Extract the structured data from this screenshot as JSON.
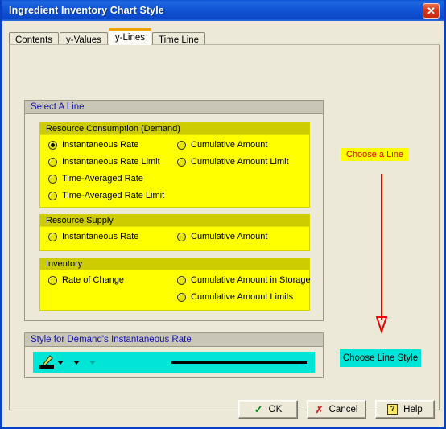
{
  "window": {
    "title": "Ingredient Inventory Chart Style",
    "close_label": "✕"
  },
  "tabs": [
    {
      "label": "Contents",
      "active": false
    },
    {
      "label": "y-Values",
      "active": false
    },
    {
      "label": "y-Lines",
      "active": true
    },
    {
      "label": "Time Line",
      "active": false
    }
  ],
  "select_a_line": {
    "header": "Select A Line",
    "panels": [
      {
        "header": "Resource Consumption (Demand)",
        "left_options": [
          {
            "label": "Instantaneous Rate",
            "checked": true
          },
          {
            "label": "Instantaneous Rate Limit",
            "checked": false
          },
          {
            "label": "Time-Averaged Rate",
            "checked": false
          },
          {
            "label": "Time-Averaged Rate Limit",
            "checked": false
          }
        ],
        "right_options": [
          {
            "label": "Cumulative Amount",
            "checked": false
          },
          {
            "label": "Cumulative Amount Limit",
            "checked": false
          }
        ]
      },
      {
        "header": "Resource Supply",
        "left_options": [
          {
            "label": "Instantaneous Rate",
            "checked": false
          }
        ],
        "right_options": [
          {
            "label": "Cumulative Amount",
            "checked": false
          }
        ]
      },
      {
        "header": "Inventory",
        "left_options": [
          {
            "label": "Rate of Change",
            "checked": false
          }
        ],
        "right_options": [
          {
            "label": "Cumulative Amount in Storage",
            "checked": false
          },
          {
            "label": "Cumulative Amount Limits",
            "checked": false
          }
        ]
      }
    ]
  },
  "style_group": {
    "header": "Style for Demand's Instantaneous Rate",
    "tools": [
      {
        "name": "line-color-picker",
        "icon": "pen-icon"
      },
      {
        "name": "line-weight-picker",
        "icon": "line-weight-icon"
      },
      {
        "name": "line-dash-picker",
        "icon": "line-dash-icon"
      }
    ]
  },
  "annotations": {
    "choose_a_line": "Choose a Line",
    "choose_line_style": "Choose Line Style",
    "arrow_color": "#ee0000",
    "highlight_color": "#ffff00",
    "button_color": "#00e5d5"
  },
  "buttons": [
    {
      "label": "OK",
      "icon": "check-icon"
    },
    {
      "label": "Cancel",
      "icon": "x-icon"
    },
    {
      "label": "Help",
      "icon": "question-icon"
    }
  ],
  "colors": {
    "dialog_bg": "#ece9d8",
    "titlebar_blue": "#0b47c8",
    "panel_yellow": "#ffff00",
    "panel_yellow_header": "#cccc00",
    "group_header_gray": "#c9c6b8",
    "group_header_text": "#1414aa",
    "accent_cyan": "#00e5d5",
    "annotation_red": "#dd0000",
    "tab_active_top": "#f0a000"
  }
}
